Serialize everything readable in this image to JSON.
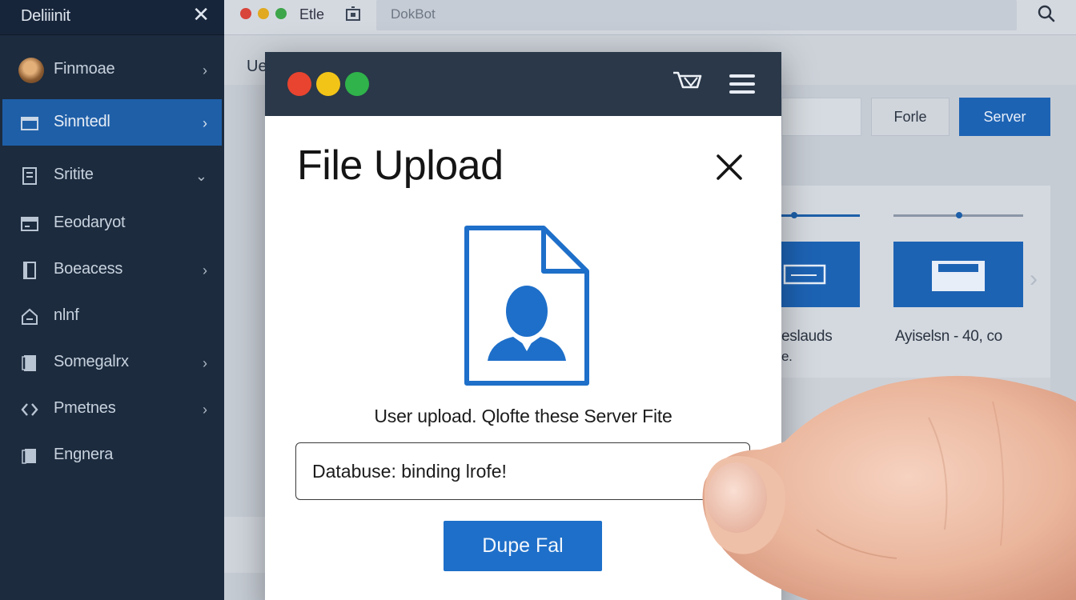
{
  "sidebar": {
    "title": "Deliiinit",
    "close_glyph": "✕",
    "items": [
      {
        "label": "Finmoae",
        "icon": "avatar",
        "chevron": "›",
        "active": false
      },
      {
        "label": "Sinntedl",
        "icon": "folder-icon",
        "chevron": "›",
        "active": true
      },
      {
        "label": "Sritite",
        "icon": "document-icon",
        "chevron": "⌄",
        "active": false
      },
      {
        "label": "Eeodaryot",
        "icon": "window-icon",
        "chevron": "",
        "active": false
      },
      {
        "label": "Boeacess",
        "icon": "book-icon",
        "chevron": "›",
        "active": false
      },
      {
        "label": "nlnf",
        "icon": "home-icon",
        "chevron": "",
        "active": false
      },
      {
        "label": "Somegalrx",
        "icon": "notebook-icon",
        "chevron": "›",
        "active": false
      },
      {
        "label": "Pmetnes",
        "icon": "code-icon",
        "chevron": "›",
        "active": false
      },
      {
        "label": "Engnera",
        "icon": "file-stack-icon",
        "chevron": "",
        "active": false
      }
    ]
  },
  "topbar": {
    "file_label": "Etle",
    "search_text": "DokBot",
    "traffic_colors": [
      "#d8453b",
      "#e0a91f",
      "#3da54a"
    ]
  },
  "background": {
    "partial_label": "Ue",
    "forle_button": "Forle",
    "server_button": "Server",
    "card_caption_left": "eslauds",
    "card_caption_left_sub": "e.",
    "card_caption_right": "Ayiselsn - 40, co"
  },
  "modal": {
    "traffic_colors": [
      "#e8442f",
      "#f2c418",
      "#2fb34a"
    ],
    "title": "File Upload",
    "close_glyph": "✕",
    "description": "User upload. Qlofte these Server Fite",
    "input_value": "Databuse: binding lrofe!",
    "button_label": "Dupe Fal",
    "accent": "#1e6fc9"
  }
}
